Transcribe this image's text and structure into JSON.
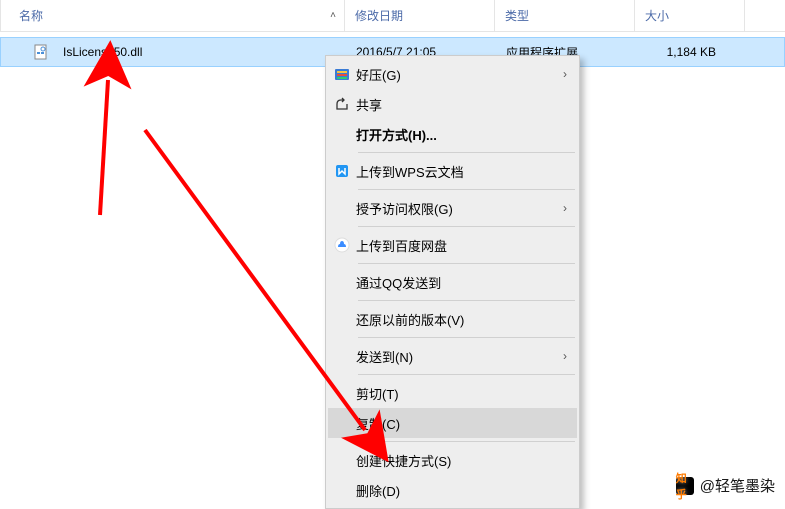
{
  "header": {
    "name": "名称",
    "date": "修改日期",
    "type": "类型",
    "size": "大小"
  },
  "file": {
    "name": "IsLicense50.dll",
    "date": "2016/5/7 21:05",
    "type": "应用程序扩展",
    "size": "1,184 KB"
  },
  "menu": {
    "haoya": "好压(G)",
    "share": "共享",
    "openwith": "打开方式(H)...",
    "wps": "上传到WPS云文档",
    "grant": "授予访问权限(G)",
    "baidu": "上传到百度网盘",
    "qq": "通过QQ发送到",
    "restore": "还原以前的版本(V)",
    "sendto": "发送到(N)",
    "cut": "剪切(T)",
    "copy": "复制(C)",
    "shortcut": "创建快捷方式(S)",
    "delete": "删除(D)"
  },
  "watermark": "@轻笔墨染"
}
